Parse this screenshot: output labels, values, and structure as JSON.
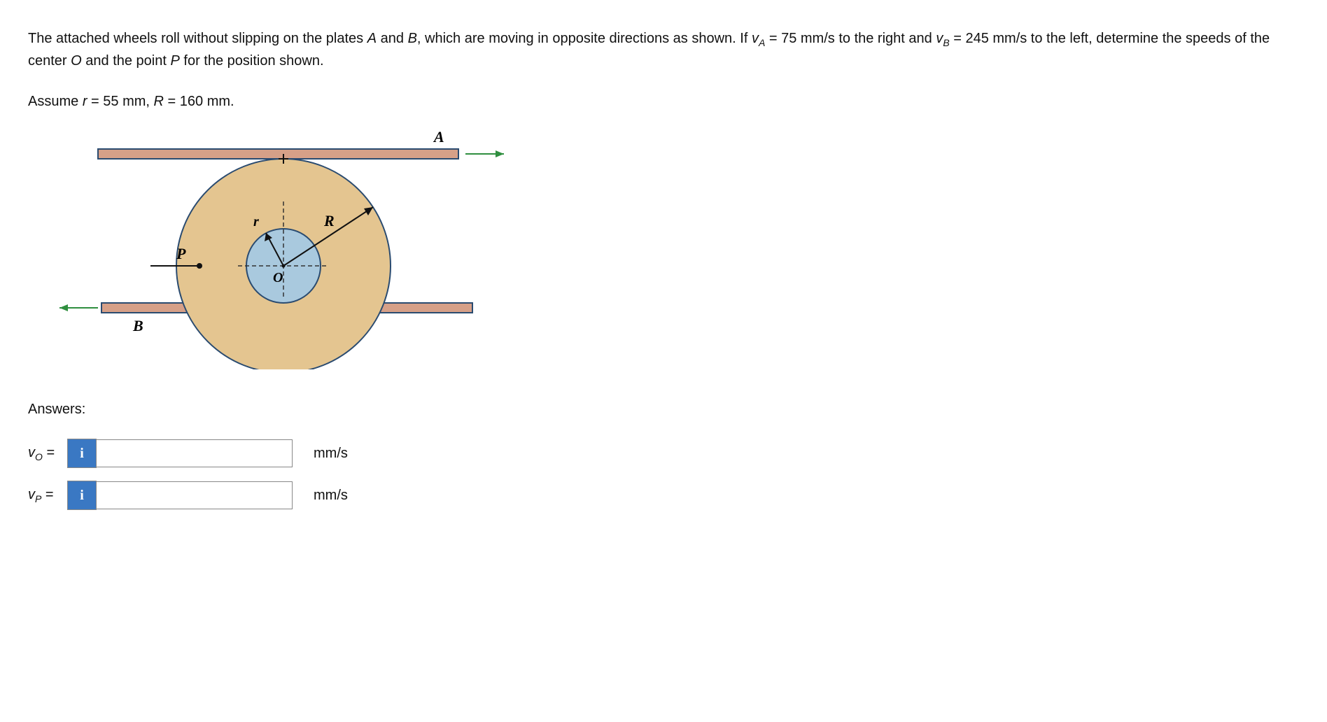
{
  "problem": {
    "line1_a": "The attached wheels roll without slipping on the plates ",
    "A": "A",
    "line1_b": " and ",
    "B": "B",
    "line1_c": ", which are moving in opposite directions as shown. If ",
    "vA_sym": "v",
    "vA_sub": "A",
    "vA_val": " = 75 mm/s to the right and ",
    "vB_sym": "v",
    "vB_sub": "B",
    "vB_val": " = 245 mm/s to the left, determine the speeds of the center ",
    "O": "O",
    "line1_d": " and the point ",
    "P": "P",
    "line1_e": " for the position shown."
  },
  "assume": {
    "prefix": "Assume ",
    "r_sym": "r",
    "r_val": " = 55 mm, ",
    "R_sym": "R",
    "R_val": " = 160 mm."
  },
  "figure": {
    "label_A": "A",
    "label_B": "B",
    "label_P": "P",
    "label_O": "O",
    "label_r": "r",
    "label_R": "R"
  },
  "answers": {
    "heading": "Answers:",
    "vO_sym": "v",
    "vO_sub": "O",
    "eq": " = ",
    "vP_sym": "v",
    "vP_sub": "P",
    "info_glyph": "i",
    "unit": "mm/s",
    "vO_value": "",
    "vP_value": ""
  }
}
